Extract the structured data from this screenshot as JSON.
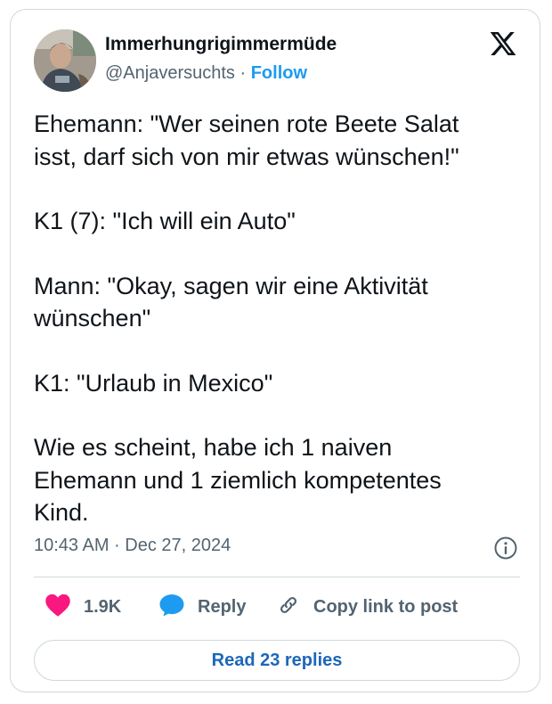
{
  "author": {
    "display_name": "Immerhungrigimmermüde",
    "handle": "@Anjaversuchts",
    "separator": "·",
    "follow_label": "Follow"
  },
  "tweet": {
    "paragraphs": [
      "Ehemann: \"Wer seinen rote Beete Salat\nisst, darf sich von mir etwas wünschen!\"",
      "K1 (7): \"Ich will ein Auto\"",
      "Mann: \"Okay, sagen wir eine Aktivität\nwünschen\"",
      "K1: \"Urlaub in Mexico\"",
      "Wie es scheint, habe ich 1 naiven\nEhemann und 1 ziemlich kompetentes\nKind."
    ],
    "timestamp": "10:43 AM · Dec 27, 2024"
  },
  "actions": {
    "like_count": "1.9K",
    "reply_label": "Reply",
    "copy_link_label": "Copy link to post"
  },
  "read_replies_label": "Read 23 replies",
  "icons": {
    "brand": "x-logo-icon",
    "info": "info-icon",
    "like": "heart-icon",
    "reply": "speech-bubble-icon",
    "copy_link": "link-icon"
  },
  "colors": {
    "text": "#0f1419",
    "secondary_text": "#536471",
    "follow": "#1d9bf0",
    "like": "#f91880",
    "reply_icon": "#1d9bf0",
    "read_replies": "#1d67b8",
    "border": "#cfd9de"
  }
}
